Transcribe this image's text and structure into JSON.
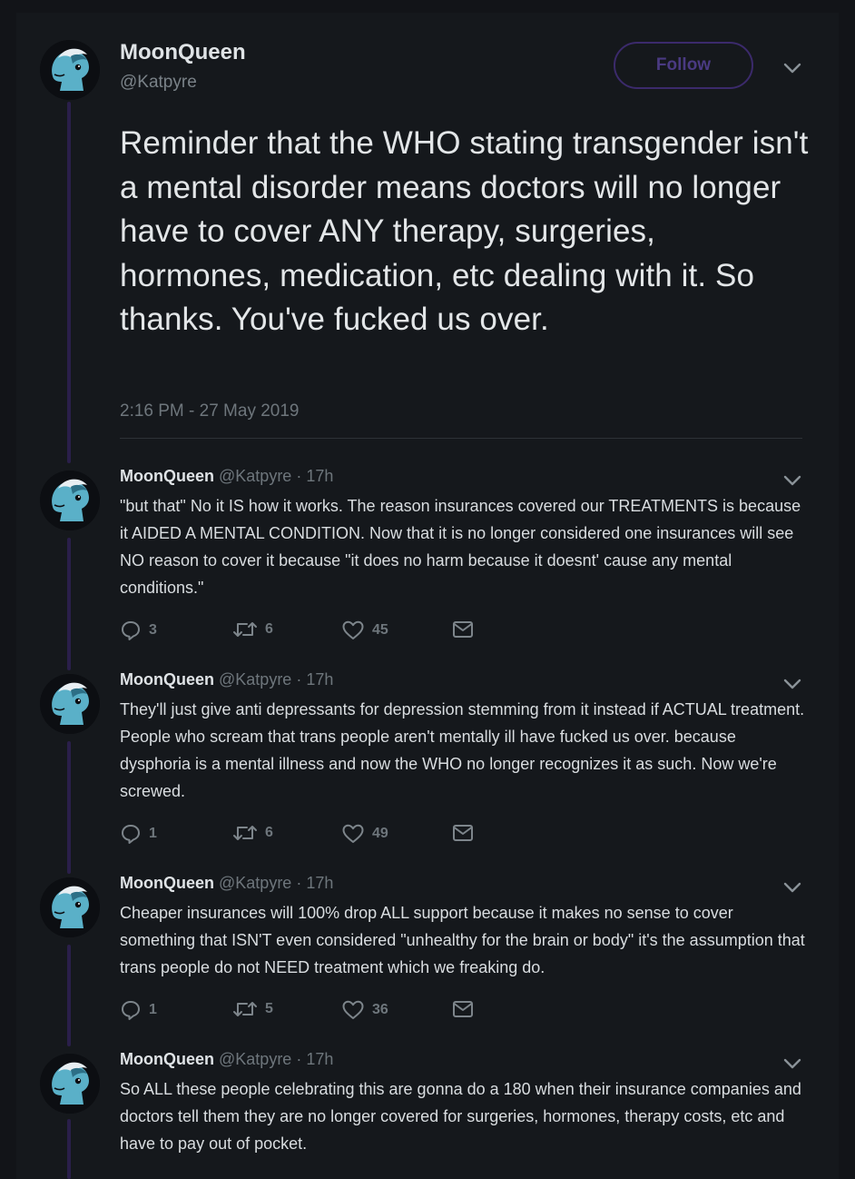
{
  "tweet": {
    "name": "MoonQueen",
    "handle": "@Katpyre",
    "follow_label": "Follow",
    "text": "Reminder that the WHO stating transgender isn't a mental disorder means doctors will no longer have to cover ANY therapy, surgeries, hormones, medication, etc dealing with it. So thanks. You've fucked us over.",
    "timestamp": "2:16 PM - 27 May 2019"
  },
  "replies": [
    {
      "name": "MoonQueen",
      "meta": "@Katpyre · 17h",
      "text": "\"but that\" No it IS how it works. The reason insurances covered our TREATMENTS is because it AIDED A MENTAL CONDITION. Now that it is no longer considered one insurances will see NO reason to cover it because \"it does no harm because it doesnt' cause any mental conditions.\"",
      "replies": "3",
      "retweets": "6",
      "likes": "45"
    },
    {
      "name": "MoonQueen",
      "meta": "@Katpyre · 17h",
      "text": "They'll just give anti depressants for depression stemming from it instead if ACTUAL treatment. People who scream that trans people aren't mentally ill have fucked us over. because dysphoria is a mental illness and now the WHO no longer recognizes it as such. Now we're screwed.",
      "replies": "1",
      "retweets": "6",
      "likes": "49"
    },
    {
      "name": "MoonQueen",
      "meta": "@Katpyre · 17h",
      "text": "Cheaper insurances will 100% drop ALL support because it makes no sense to cover something that ISN'T even considered \"unhealthy for the brain or body\" it's the assumption that trans people do not NEED treatment which we freaking do.",
      "replies": "1",
      "retweets": "5",
      "likes": "36"
    },
    {
      "name": "MoonQueen",
      "meta": "@Katpyre · 17h",
      "text": "So ALL these people celebrating this are gonna do a 180 when their insurance companies and doctors tell them they are no longer covered for surgeries, hormones, therapy costs, etc and have to pay out of pocket."
    }
  ],
  "icons": {
    "reply": "reply-icon",
    "retweet": "retweet-icon",
    "like": "heart-icon",
    "dm": "envelope-icon",
    "menu": "chevron-down-icon"
  },
  "colors": {
    "background": "#15181c",
    "thread_line": "#2a1f4a",
    "follow_accent": "#4a3a82",
    "avatar_accent": "#5ab0c8"
  }
}
